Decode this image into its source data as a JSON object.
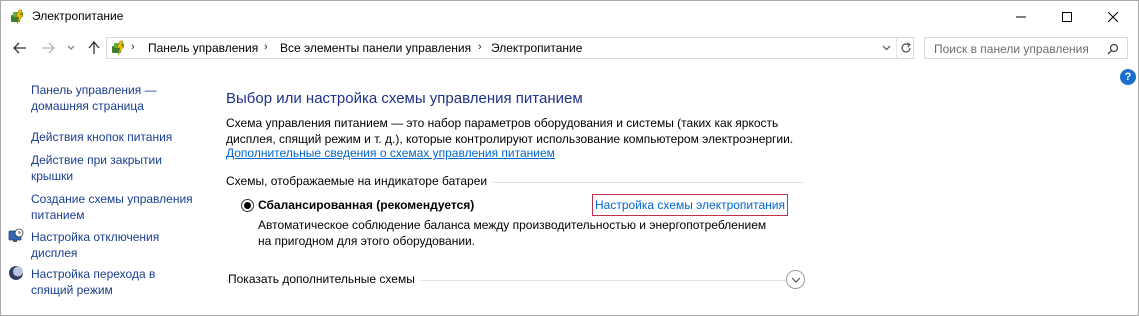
{
  "window": {
    "title": "Электропитание"
  },
  "nav": {
    "breadcrumbs": [
      "Панель управления",
      "Все элементы панели управления",
      "Электропитание"
    ],
    "search_placeholder": "Поиск в панели управления"
  },
  "help": {
    "label": "?"
  },
  "sidebar": {
    "items": [
      {
        "label": "Панель управления — домашняя страница",
        "icon": "none"
      },
      {
        "label": "Действия кнопок питания",
        "icon": "none"
      },
      {
        "label": "Действие при закрытии крышки",
        "icon": "none"
      },
      {
        "label": "Создание схемы управления питанием",
        "icon": "none"
      },
      {
        "label": "Настройка отключения дисплея",
        "icon": "display-clock-icon"
      },
      {
        "label": "Настройка перехода в спящий режим",
        "icon": "moon-icon"
      }
    ]
  },
  "main": {
    "title": "Выбор или настройка схемы управления питанием",
    "description": "Схема управления питанием — это набор параметров оборудования и системы (таких как яркость дисплея, спящий режим и т. д.), которые контролируют использование компьютером электроэнергии.",
    "more_info_link": "Дополнительные сведения о схемах управления питанием",
    "section_label": "Схемы, отображаемые на индикаторе батареи",
    "plan": {
      "name": "Сбалансированная (рекомендуется)",
      "selected": true,
      "settings_link": "Настройка схемы электропитания",
      "description": "Автоматическое соблюдение баланса между производительностью и энергопотреблением на пригодном для этого оборудовании."
    },
    "show_more_label": "Показать дополнительные схемы"
  },
  "colors": {
    "link": "#1a3e8f",
    "title": "#1e3287",
    "hyperlink": "#0066cc",
    "focus_border": "#c0304a"
  }
}
